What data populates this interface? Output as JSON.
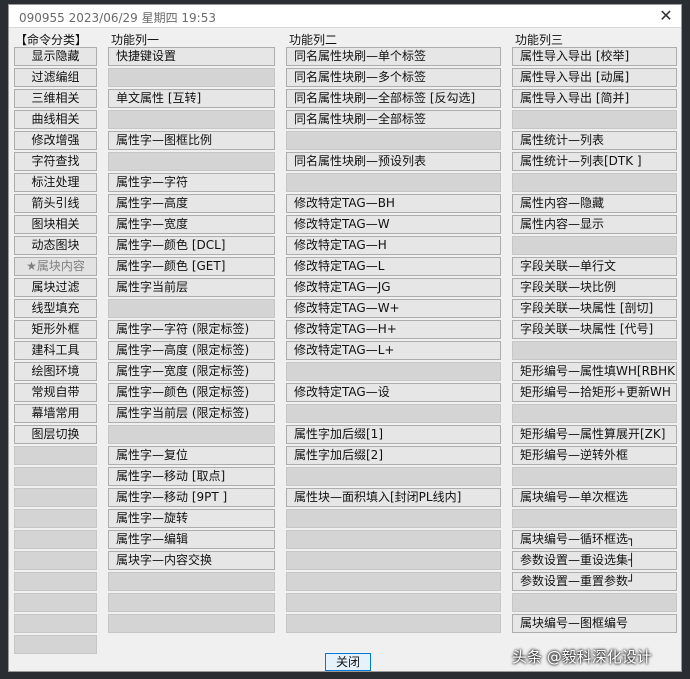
{
  "window": {
    "title": "090955 2023/06/29 星期四 19:53"
  },
  "headers": {
    "categories": "【命令分类】",
    "col1": "功能列一",
    "col2": "功能列二",
    "col3": "功能列三"
  },
  "categories": [
    "显示隐藏",
    "过滤编组",
    "三维相关",
    "曲线相关",
    "修改增强",
    "字符查找",
    "标注处理",
    "箭头引线",
    "图块相关",
    "动态图块",
    "★属块内容",
    "属块过滤",
    "线型填充",
    "矩形外框",
    "建科工具",
    "绘图环境",
    "常规自带",
    "幕墙常用",
    "图层切换",
    "",
    "",
    "",
    "",
    "",
    "",
    "",
    "",
    "",
    ""
  ],
  "selected_category_index": 10,
  "col1": [
    "快捷键设置",
    "",
    "单文属性 [互转]",
    "",
    "属性字—图框比例",
    "",
    "属性字—字符",
    "属性字—高度",
    "属性字—宽度",
    "属性字—颜色 [DCL]",
    "属性字—颜色 [GET]",
    "属性字当前层",
    "",
    "属性字—字符 (限定标签)",
    "属性字—高度 (限定标签)",
    "属性字—宽度 (限定标签)",
    "属性字—颜色 (限定标签)",
    "属性字当前层 (限定标签)",
    "",
    "属性字—复位",
    "属性字—移动 [取点]",
    "属性字—移动 [9PT ]",
    "属性字—旋转",
    "属性字—编辑",
    "属块字—内容交换",
    "",
    "",
    ""
  ],
  "col2": [
    "同名属性块刷—单个标签",
    "同名属性块刷—多个标签",
    "同名属性块刷—全部标签 [反勾选]",
    "同名属性块刷—全部标签",
    "",
    "同名属性块刷—预设列表",
    "",
    "修改特定TAG—BH",
    "修改特定TAG—W",
    "修改特定TAG—H",
    "修改特定TAG—L",
    "修改特定TAG—JG",
    "修改特定TAG—W+",
    "修改特定TAG—H+",
    "修改特定TAG—L+",
    "",
    "修改特定TAG—设",
    "",
    "属性字加后缀[1]",
    "属性字加后缀[2]",
    "",
    "属性块—面积填入[封闭PL线内]",
    "",
    "",
    "",
    "",
    "",
    ""
  ],
  "col3": [
    "属性导入导出 [校举]",
    "属性导入导出 [动属]",
    "属性导入导出 [简并]",
    "",
    "属性统计—列表",
    "属性统计—列表[DTK ]",
    "",
    "属性内容—隐藏",
    "属性内容—显示",
    "",
    "字段关联—单行文",
    "字段关联—块比例",
    "字段关联—块属性 [剖切]",
    "字段关联—块属性 [代号]",
    "",
    "矩形编号—属性填WH[RBHK]",
    "矩形编号—拾矩形+更新WH",
    "",
    "矩形编号—属性算展开[ZK]",
    "矩形编号—逆转外框",
    "",
    "属块编号—单次框选",
    "",
    "属块编号—循环框选┐",
    "参数设置—重设选集┤",
    "参数设置—重置参数┘",
    "",
    "属块编号—图框编号"
  ],
  "footer": {
    "close_label": "关闭"
  },
  "watermark": "头条 @毅科深化设计"
}
